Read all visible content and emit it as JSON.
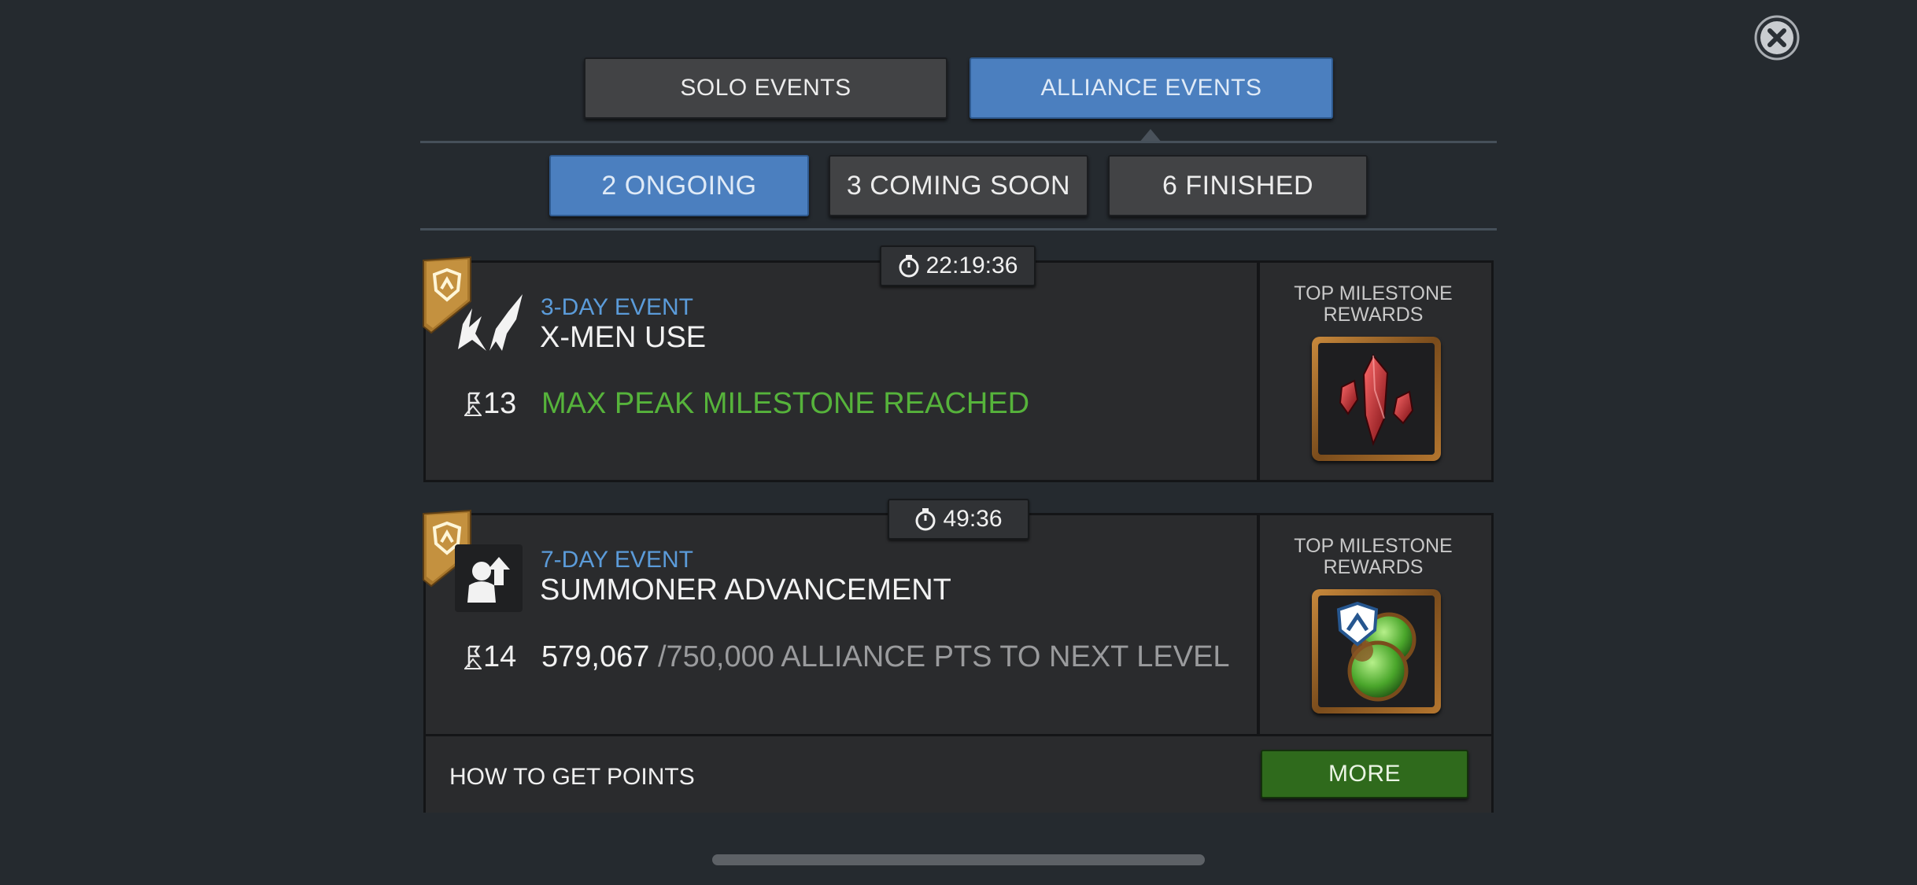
{
  "top_tabs": {
    "solo": "SOLO EVENTS",
    "alliance": "ALLIANCE EVENTS",
    "active": "alliance"
  },
  "sub_tabs": {
    "ongoing": "2 ONGOING",
    "coming_soon": "3 COMING SOON",
    "finished": "6 FINISHED",
    "active": "ongoing"
  },
  "events": [
    {
      "timer": "22:19:36",
      "type": "3-DAY EVENT",
      "title": "X-MEN USE",
      "level": "13",
      "status": "MAX PEAK MILESTONE REACHED",
      "rewards_label": "TOP MILESTONE REWARDS",
      "reward_icon": "red-crystal-shards-icon"
    },
    {
      "timer": "49:36",
      "type": "7-DAY EVENT",
      "title": "SUMMONER ADVANCEMENT",
      "level": "14",
      "points_current": "579,067",
      "points_target": "/750,000 ALLIANCE PTS TO NEXT LEVEL",
      "rewards_label": "TOP MILESTONE REWARDS",
      "reward_icon": "alliance-green-orbs-icon"
    }
  ],
  "footer": {
    "how_to": "HOW TO GET POINTS",
    "more": "MORE"
  },
  "colors": {
    "background": "#252a2f",
    "accent_blue": "#4b7fbf",
    "event_type_blue": "#5b9bd9",
    "success_green": "#56b33b",
    "more_button": "#2f6a1c"
  }
}
